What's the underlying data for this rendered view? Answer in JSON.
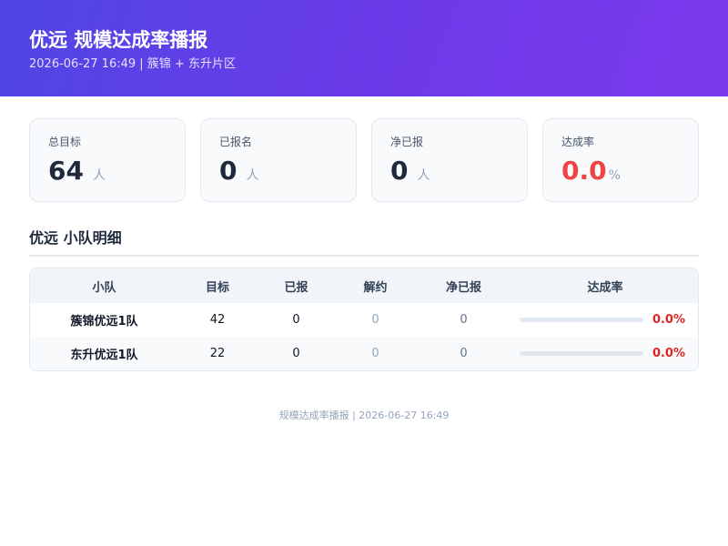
{
  "header": {
    "title": "优远 规模达成率播报",
    "subtitle": "2026-06-27 16:49 | 簇锦 + 东升片区"
  },
  "cards": [
    {
      "label": "总目标",
      "value": "64",
      "unit": "人"
    },
    {
      "label": "已报名",
      "value": "0",
      "unit": "人"
    },
    {
      "label": "净已报",
      "value": "0",
      "unit": "人"
    },
    {
      "label": "达成率",
      "value": "0.0",
      "unit": "%"
    }
  ],
  "colors": {
    "accent_red": "#ef4444",
    "rate_red": "#dc2626",
    "header_start": "#4f46e5",
    "header_end": "#7c3aed"
  },
  "section": {
    "title": "优远 小队明细"
  },
  "table": {
    "columns": [
      "小队",
      "目标",
      "已报",
      "解约",
      "净已报",
      "达成率"
    ],
    "rows": [
      {
        "team": "簇锦优远1队",
        "target": "42",
        "reported": "0",
        "cancelled": "0",
        "net": "0",
        "rate": "0.0%",
        "rate_value": 0
      },
      {
        "team": "东升优远1队",
        "target": "22",
        "reported": "0",
        "cancelled": "0",
        "net": "0",
        "rate": "0.0%",
        "rate_value": 0
      }
    ]
  },
  "footer": {
    "text": "规模达成率播报 | 2026-06-27 16:49"
  }
}
